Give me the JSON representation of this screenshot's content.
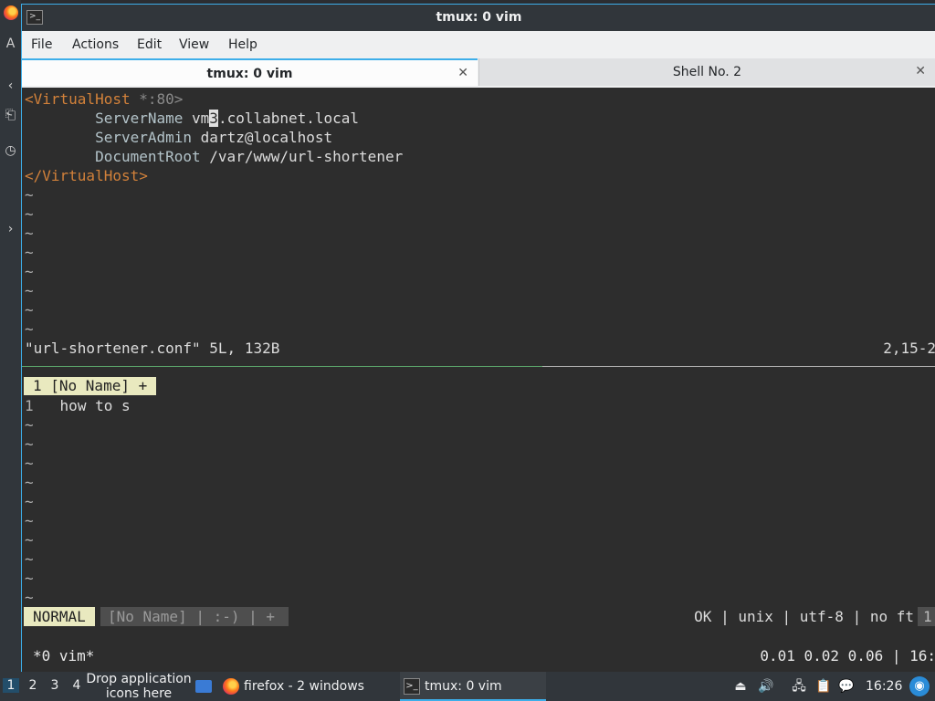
{
  "window": {
    "title": "tmux: 0 vim",
    "menu": [
      "File",
      "Actions",
      "Edit",
      "View",
      "Help"
    ],
    "tabs": [
      {
        "label": "tmux: 0 vim",
        "active": true
      },
      {
        "label": "Shell No. 2",
        "active": false
      }
    ],
    "close_glyph": "✕"
  },
  "vim_top": {
    "lines": {
      "l1_open": "<VirtualHost",
      "l1_rest": " *:80>",
      "l2_key": "ServerName",
      "l2_val_pre": " vm",
      "l2_cursor": "3",
      "l2_val_post": ".collabnet.local",
      "l3_key": "ServerAdmin",
      "l3_val": " dartz@localhost",
      "l4_key": "DocumentRoot",
      "l4_val": " /var/www/url-shortener",
      "l5": "</VirtualHost>"
    },
    "tilde": "~",
    "message": "\"url-shortener.conf\" 5L, 132B",
    "ruler": "2,15-2"
  },
  "vim_bottom": {
    "buffer_tab": "1 [No Name] +",
    "line_number": "1",
    "line_text": "how to s",
    "tilde": "~",
    "mode": "NORMAL",
    "status_mid": "[No Name] | :-) | +",
    "status_right": "OK | unix | utf-8 | no ft",
    "status_right_end": "1"
  },
  "tmux": {
    "left": "*0 vim*",
    "right": "0.01 0.02 0.06 | 16:"
  },
  "taskbar": {
    "desktops": [
      "1",
      "2",
      "3",
      "4"
    ],
    "drop_hint": "Drop application icons here",
    "tasks": [
      {
        "label": "firefox - 2 windows",
        "icon": "firefox-icon"
      },
      {
        "label": "tmux: 0 vim",
        "icon": "terminal-icon"
      }
    ],
    "clock": "16:26"
  },
  "left_strip": {
    "fragments": [
      "A",
      "‹",
      "⎗",
      "◷",
      "›"
    ]
  },
  "colors": {
    "accent": "#3daee9",
    "vim_tag": "#d2813a",
    "vim_attr": "#b3c3c9",
    "statusline_highlight": "#e9e9bf"
  }
}
